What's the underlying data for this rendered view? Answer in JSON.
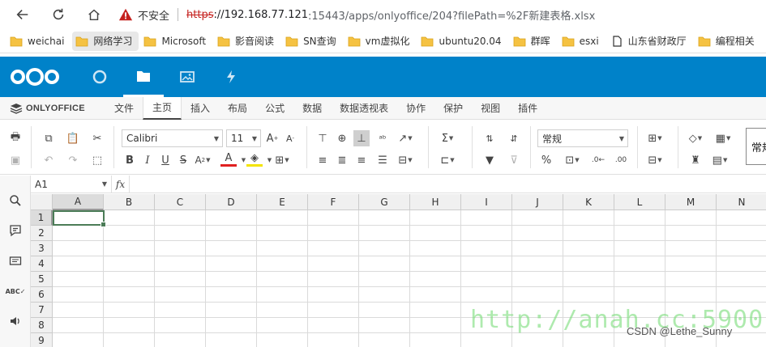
{
  "browser": {
    "insecure_label": "不安全",
    "url_scheme": "https",
    "url_host": "://192.168.77.121",
    "url_rest": ":15443/apps/onlyoffice/204?filePath=%2F新建表格.xlsx"
  },
  "bookmarks": [
    {
      "label": "weichai",
      "icon": "folder-icon"
    },
    {
      "label": "网络学习",
      "icon": "folder-icon"
    },
    {
      "label": "Microsoft",
      "icon": "folder-icon"
    },
    {
      "label": "影音阅读",
      "icon": "folder-icon"
    },
    {
      "label": "SN查询",
      "icon": "folder-icon"
    },
    {
      "label": "vm虚拟化",
      "icon": "folder-icon"
    },
    {
      "label": "ubuntu20.04",
      "icon": "folder-icon"
    },
    {
      "label": "群晖",
      "icon": "folder-icon"
    },
    {
      "label": "esxi",
      "icon": "folder-icon"
    },
    {
      "label": "山东省财政厅",
      "icon": "page-icon"
    },
    {
      "label": "编程相关",
      "icon": "folder-icon"
    }
  ],
  "nextcloud": {
    "brand_color": "#0082c9"
  },
  "onlyoffice": {
    "brand": "ONLYOFFICE",
    "tabs": [
      "文件",
      "主页",
      "插入",
      "布局",
      "公式",
      "数据",
      "数据透视表",
      "协作",
      "保护",
      "视图",
      "插件"
    ],
    "active_tab": "主页",
    "font_name": "Calibri",
    "font_size": "11",
    "number_format": "常规",
    "cell_style_preview": "常规"
  },
  "formula": {
    "name_box": "A1",
    "fx": "fx",
    "value": ""
  },
  "sheet": {
    "columns": [
      "A",
      "B",
      "C",
      "D",
      "E",
      "F",
      "G",
      "H",
      "I",
      "J",
      "K",
      "L",
      "M",
      "N"
    ],
    "rows": [
      "1",
      "2",
      "3",
      "4",
      "5",
      "6",
      "7",
      "8",
      "9"
    ],
    "selected_cell": "A1"
  },
  "overlay": {
    "watermark": "http://anah.cc:5900",
    "credit": "CSDN @Lethe_Sunny",
    "watermark_color": "#78dc78"
  }
}
